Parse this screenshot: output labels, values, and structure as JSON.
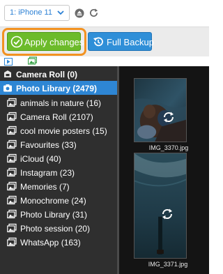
{
  "device_selector": {
    "value": "1: iPhone 11"
  },
  "toolbar": {
    "apply_label": "Apply changes",
    "backup_label": "Full Backup"
  },
  "sidebar": {
    "items": [
      {
        "label": "Camera Roll (0)",
        "icon": "camera-roll-icon",
        "bold": true
      },
      {
        "label": "Photo Library (2479)",
        "icon": "camera-icon",
        "bold": true,
        "selected": true
      },
      {
        "label": "animals in nature (16)",
        "icon": "album-icon"
      },
      {
        "label": "Camera Roll (2107)",
        "icon": "album-icon"
      },
      {
        "label": "cool movie posters (15)",
        "icon": "album-icon"
      },
      {
        "label": "Favourites (33)",
        "icon": "album-icon"
      },
      {
        "label": "iCloud (40)",
        "icon": "album-icon"
      },
      {
        "label": "Instagram (23)",
        "icon": "album-icon"
      },
      {
        "label": "Memories (7)",
        "icon": "album-icon"
      },
      {
        "label": "Monochrome (24)",
        "icon": "album-icon"
      },
      {
        "label": "Photo Library (31)",
        "icon": "album-icon"
      },
      {
        "label": "Photo session (20)",
        "icon": "album-icon"
      },
      {
        "label": "WhatsApp (163)",
        "icon": "album-icon"
      }
    ]
  },
  "photos": [
    {
      "name": "IMG_3370.jpg"
    },
    {
      "name": "IMG_3371.jpg"
    }
  ],
  "colors": {
    "accent_blue": "#2e86d4",
    "apply_green": "#6cbb2a",
    "highlight_orange": "#f29221",
    "panel_dark": "#2f2f2f"
  }
}
